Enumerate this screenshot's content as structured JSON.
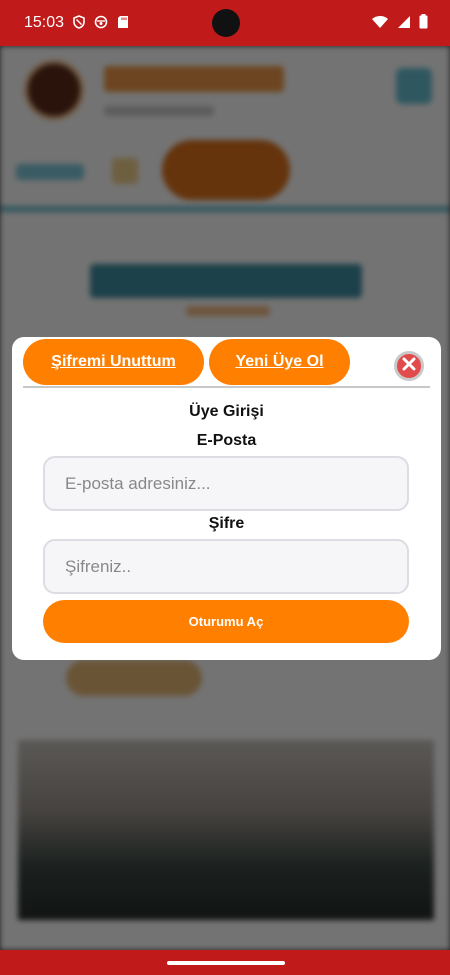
{
  "status_bar": {
    "time": "15:03",
    "icons": [
      "vpn-shield-icon",
      "media-icon",
      "sd-card-icon",
      "wifi-icon",
      "signal-icon",
      "battery-icon"
    ],
    "bar_color": "#c01a1a"
  },
  "modal": {
    "tabs": {
      "forgot_password": "Şifremi Unuttum",
      "new_member": "Yeni Üye Ol"
    },
    "close_icon": "close-icon",
    "heading": "Üye Girişi",
    "email": {
      "label": "E-Posta",
      "placeholder": "E-posta adresiniz..."
    },
    "password": {
      "label": "Şifre",
      "placeholder": "Şifreniz.."
    },
    "submit_label": "Oturumu Aç",
    "accent_color": "#ff7f00"
  }
}
